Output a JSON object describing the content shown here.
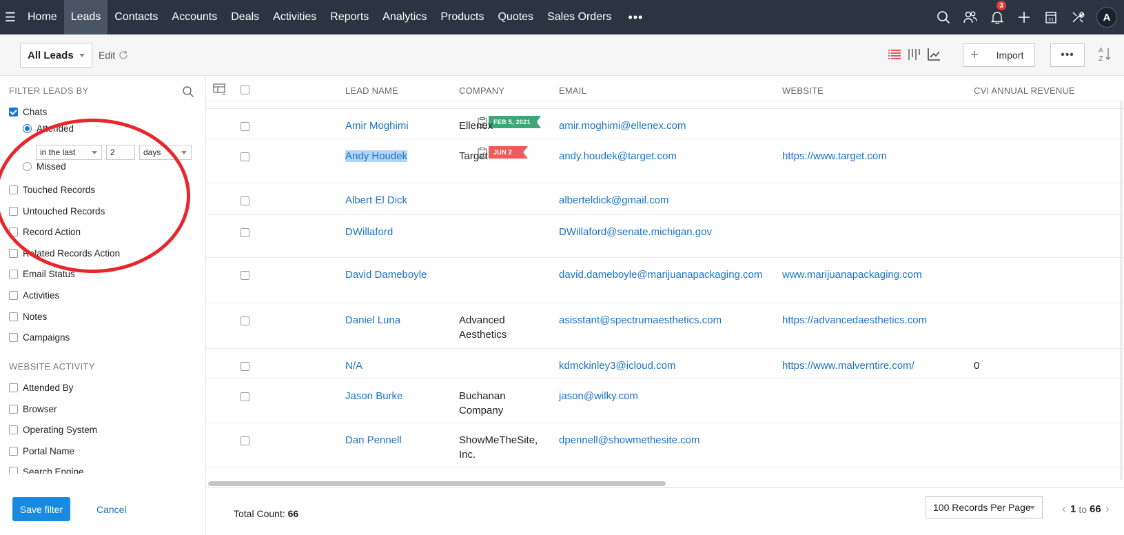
{
  "nav": {
    "items": [
      "Home",
      "Leads",
      "Contacts",
      "Accounts",
      "Deals",
      "Activities",
      "Reports",
      "Analytics",
      "Products",
      "Quotes",
      "Sales Orders"
    ],
    "active": "Leads",
    "more": "•••",
    "notification_count": "3",
    "avatar_letter": "A"
  },
  "toolbar": {
    "view_name": "All Leads",
    "edit_label": "Edit",
    "import_label": "Import",
    "more_label": "•••",
    "plus_label": "+"
  },
  "sidebar": {
    "heading": "FILTER LEADS BY",
    "chats": {
      "label": "Chats",
      "checked": true
    },
    "attended_label": "Attended",
    "missed_label": "Missed",
    "range_select": "in the last",
    "range_value": "2",
    "range_unit": "days",
    "filters": [
      "Touched Records",
      "Untouched Records",
      "Record Action",
      "Related Records Action",
      "Email Status",
      "Activities",
      "Notes",
      "Campaigns"
    ],
    "website_heading": "WEBSITE ACTIVITY",
    "website_filters": [
      "Attended By",
      "Browser",
      "Operating System",
      "Portal Name",
      "Search Engine"
    ],
    "save_label": "Save filter",
    "cancel_label": "Cancel"
  },
  "table": {
    "columns": [
      "LEAD NAME",
      "COMPANY",
      "EMAIL",
      "WEBSITE",
      "CVI ANNUAL REVENUE"
    ],
    "rows": [
      {
        "name": "Amir Moghimi",
        "company": "Ellenex",
        "company2": "",
        "email": "amir.moghimi@ellenex.com",
        "website": "",
        "revenue": "",
        "flag": "FEB 5, 2021",
        "flag_color": "#3fa67a"
      },
      {
        "name": "Andy Houdek",
        "company": "Target",
        "company2": "",
        "email": "andy.houdek@target.com",
        "website": "https://www.target.com",
        "revenue": "",
        "flag": "JUN 2",
        "flag_color": "#ef5b5b"
      },
      {
        "name": "Albert El Dick",
        "company": "",
        "company2": "",
        "email": "alberteldick@gmail.com",
        "website": "",
        "revenue": "",
        "flag": ""
      },
      {
        "name": "DWillaford",
        "company": "",
        "company2": "",
        "email": "DWillaford@senate.michigan.gov",
        "website": "",
        "revenue": "",
        "flag": ""
      },
      {
        "name": "David Dameboyle",
        "company": "",
        "company2": "",
        "email": "david.dameboyle@marijuanapackaging.com",
        "website": "www.marijuanapackaging.com",
        "revenue": "",
        "flag": ""
      },
      {
        "name": "Daniel Luna",
        "company": "Advanced",
        "company2": "Aesthetics",
        "email": "asisstant@spectrumaesthetics.com",
        "website": "https://advancedaesthetics.com",
        "revenue": "",
        "flag": ""
      },
      {
        "name": "N/A",
        "company": "",
        "company2": "",
        "email": "kdmckinley3@icloud.com",
        "website": "https://www.malverntire.com/",
        "revenue": "0",
        "flag": ""
      },
      {
        "name": "Jason Burke",
        "company": "Buchanan",
        "company2": "Company",
        "email": "jason@wilky.com",
        "website": "",
        "revenue": "",
        "flag": ""
      },
      {
        "name": "Dan Pennell",
        "company": "ShowMeTheSite,",
        "company2": "Inc.",
        "email": "dpennell@showmethesite.com",
        "website": "",
        "revenue": "",
        "flag": ""
      }
    ]
  },
  "footer": {
    "total_label": "Total Count:",
    "total_value": "66",
    "per_page": "100 Records Per Page",
    "page_from": "1",
    "page_to_word": "to",
    "page_to": "66"
  }
}
